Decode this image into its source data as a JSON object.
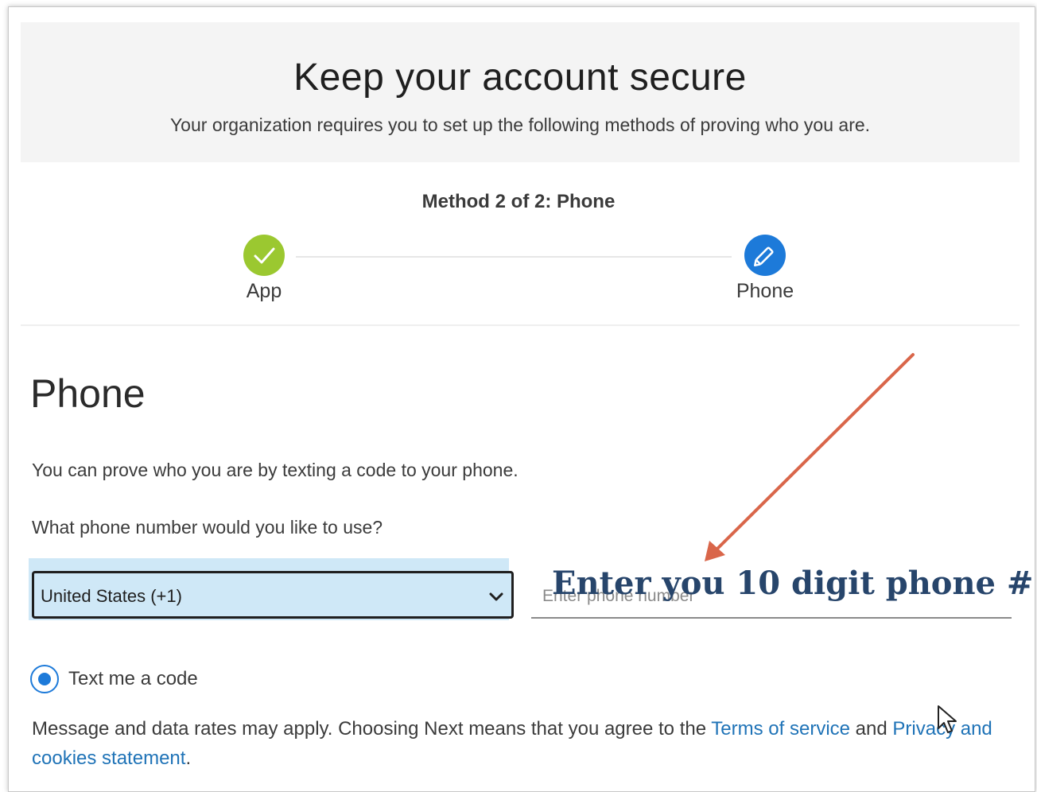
{
  "header": {
    "title": "Keep your account secure",
    "subtitle": "Your organization requires you to set up the following methods of proving who you are."
  },
  "progress": {
    "label": "Method 2 of 2: Phone",
    "steps": [
      {
        "label": "App",
        "state": "complete",
        "icon": "checkmark-icon",
        "color": "#9bc830"
      },
      {
        "label": "Phone",
        "state": "current",
        "icon": "pencil-icon",
        "color": "#1d7ad9"
      }
    ]
  },
  "phone": {
    "title": "Phone",
    "description": "You can prove who you are by texting a code to your phone.",
    "question": "What phone number would you like to use?",
    "country_value": "United States (+1)",
    "phone_placeholder": "Enter phone number",
    "option_label": "Text me a code",
    "terms": {
      "prefix": "Message and data rates may apply. Choosing Next means that you agree to the ",
      "tos_link": "Terms of service",
      "middle": " and ",
      "privacy_link": "Privacy and cookies statement",
      "suffix": "."
    }
  },
  "annotation": {
    "text": "Enter you 10 digit phone #",
    "arrow_color": "#d9664a",
    "text_color": "#27456b"
  }
}
